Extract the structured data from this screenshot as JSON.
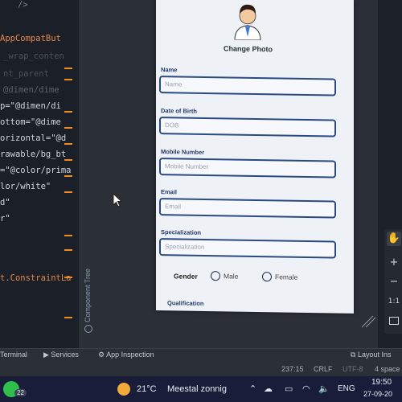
{
  "code_lines": [
    {
      "text": "/>",
      "color": "#7f8893"
    },
    {
      "text": "AppCompatBut",
      "color": "#e8874a"
    },
    {
      "text": "_wrap_conten",
      "color": "#a6b2c0"
    },
    {
      "text": "nt_parent",
      "color": "#a6b2c0"
    },
    {
      "text": "@dimen/dime",
      "color": "#a6b2c0"
    },
    {
      "text": "p=\"@dimen/di",
      "color": "#cfd5df"
    },
    {
      "text": "ottom=\"@dime",
      "color": "#cfd5df"
    },
    {
      "text": "orizontal=\"@d",
      "color": "#cfd5df"
    },
    {
      "text": "rawable/bg_bt",
      "color": "#cfd5df"
    },
    {
      "text": "=\"@color/prima",
      "color": "#cfd5df"
    },
    {
      "text": "lor/white\"",
      "color": "#cfd5df"
    },
    {
      "text": "d\"",
      "color": "#cfd5df"
    },
    {
      "text": "r\"",
      "color": "#cfd5df"
    },
    {
      "text": "t.ConstraintLa",
      "color": "#e8874a"
    }
  ],
  "form": {
    "change_photo": "Change Photo",
    "name_label": "Name",
    "name_placeholder": "Name",
    "dob_label": "Date of Birth",
    "dob_placeholder": "DOB",
    "mobile_label": "Mobile Number",
    "mobile_placeholder": "Mobile Number",
    "email_label": "Email",
    "email_placeholder": "Email",
    "spec_label": "Specialization",
    "spec_placeholder": "Specialization",
    "gender_label": "Gender",
    "male_label": "Male",
    "female_label": "Female",
    "qualification_label": "Qualification"
  },
  "component_tree_label": "Component Tree",
  "right_tools": [
    "hand-icon",
    "zoom-in-icon",
    "zoom-out-icon",
    "1:1",
    "fit-screen-icon"
  ],
  "tool_windows": {
    "terminal": "Terminal",
    "services": "Services",
    "app_inspection": "App Inspection",
    "layout_inspector": "Layout Ins"
  },
  "status": {
    "position": "237:15",
    "line_sep": "CRLF",
    "encoding": "UTF-8",
    "indent": "4 space"
  },
  "taskbar": {
    "whatsapp_badge": "22",
    "temperature": "21°C",
    "weather": "Meestal zonnig",
    "language": "ENG",
    "time": "19:50",
    "date": "27-09-20"
  },
  "colors": {
    "accent_orange": "#f08a24",
    "field_border": "#2a4a82",
    "taskbar_bg": "#1a1d3a"
  }
}
